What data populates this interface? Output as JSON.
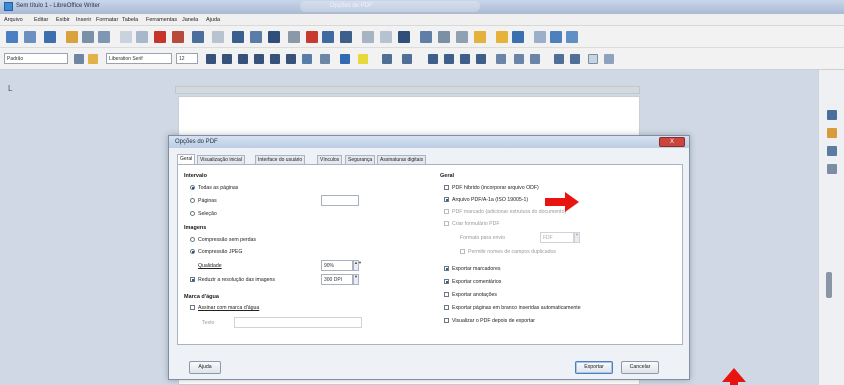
{
  "window": {
    "title": "Sem título 1 - LibreOffice Writer",
    "center_title": "Opções de PDF"
  },
  "menubar": [
    "Arquivo",
    "Editar",
    "Exibir",
    "Inserir",
    "Formatar",
    "Tabela",
    "Ferramentas",
    "Janela",
    "Ajuda"
  ],
  "toolbar": {
    "paragraph_style": "Padrão",
    "font_name": "Liberation Serif",
    "font_size": "12"
  },
  "ruler": {
    "left_marker": "L"
  },
  "dialog": {
    "title": "Opções do PDF",
    "close_label": "X",
    "tabs": [
      "Geral",
      "Visualização inicial",
      "Interface do usuário",
      "Vínculos",
      "Segurança",
      "Assinaturas digitais"
    ],
    "interval": {
      "title": "Intervalo",
      "options": [
        "Todas as páginas",
        "Páginas",
        "Seleção"
      ],
      "pages_value": ""
    },
    "images": {
      "title": "Imagens",
      "options": [
        "Compressão sem perdas",
        "Compressão JPEG"
      ],
      "quality_label": "Qualidade",
      "quality_value": "90%",
      "reduce_label": "Reduzir a resolução das imagens",
      "reduce_value": "300 DPI"
    },
    "watermark": {
      "title": "Marca d'água",
      "sign_label": "Assinar com marca d'água",
      "text_label": "Texto",
      "text_value": ""
    },
    "general": {
      "title": "Geral",
      "options": [
        "PDF híbrido (incorporar arquivo ODF)",
        "Arquivo PDF/A-1a (ISO 19005-1)",
        "PDF marcado (adicionar estrutura do documento)",
        "Criar formulário PDF",
        "Formato para envio",
        "Permitir nomes de campos duplicados",
        "Exportar marcadores",
        "Exportar comentários",
        "Exportar anotações",
        "Exportar páginas em branco inseridas automaticamente",
        "Visualizar o PDF depois de exportar"
      ],
      "submit_format": "FDF"
    },
    "buttons": {
      "help": "Ajuda",
      "export": "Exportar",
      "cancel": "Cancelar"
    }
  },
  "colors": {
    "dialog_bg": "#eef1f6",
    "accent_red": "#e8140f",
    "titlebar": "#bccde4"
  }
}
